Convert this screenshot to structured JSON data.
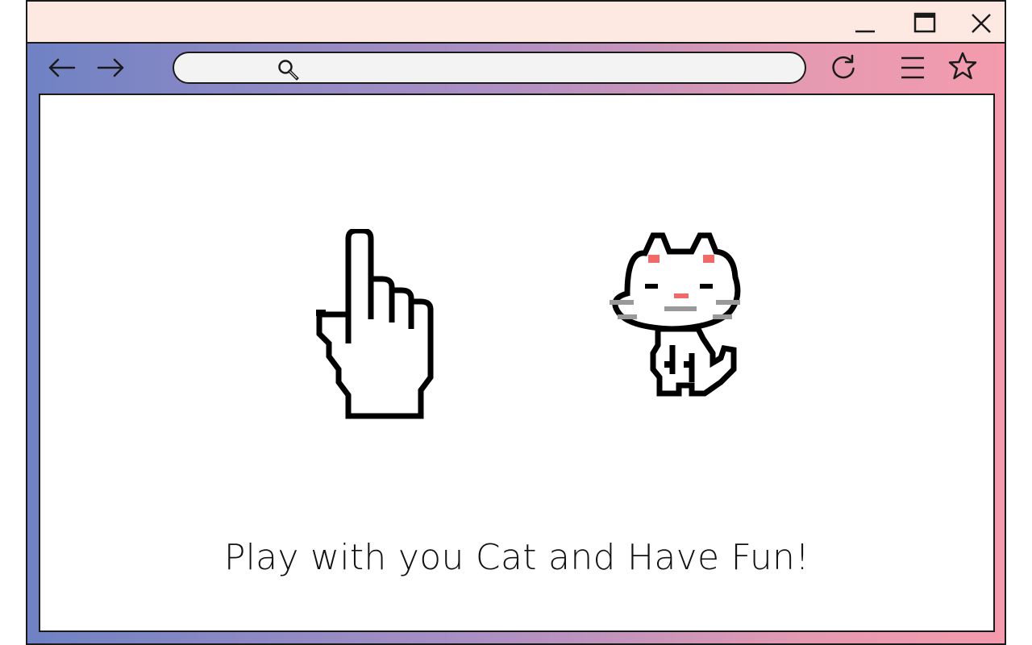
{
  "window": {
    "controls": {
      "minimize_icon": "minimize-icon",
      "maximize_icon": "maximize-icon",
      "close_icon": "close-icon"
    }
  },
  "toolbar": {
    "back_icon": "arrow-left-icon",
    "forward_icon": "arrow-right-icon",
    "reload_icon": "reload-icon",
    "menu_icon": "hamburger-menu-icon",
    "bookmark_icon": "star-icon"
  },
  "address_bar": {
    "icon": "search-icon",
    "value": "",
    "placeholder": ""
  },
  "content": {
    "hand_image": "pixel-pointer-hand",
    "cat_image": "pixel-cat",
    "tagline": "Play with you Cat and Have Fun!"
  },
  "colors": {
    "titlebar": "#fde9e2",
    "gradient_start": "#6f82c4",
    "gradient_end": "#f49bad",
    "cat_accent": "#f06a6a",
    "cat_whisker": "#999999"
  }
}
